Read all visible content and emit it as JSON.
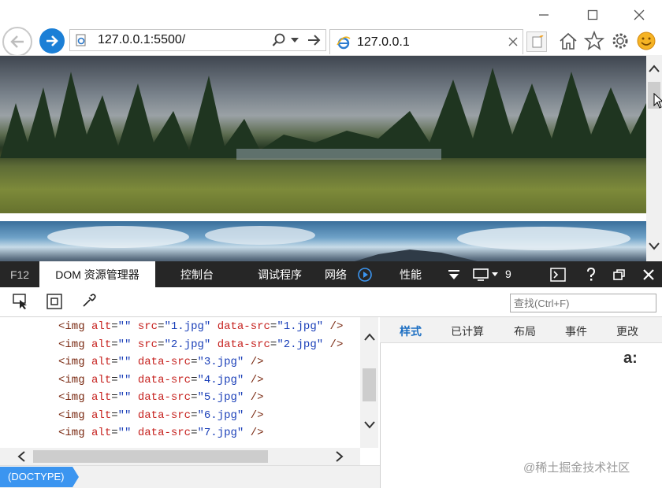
{
  "browser": {
    "address": "127.0.0.1:5500/",
    "tab_title": "127.0.0.1"
  },
  "devtools": {
    "tabs": [
      "F12",
      "DOM 资源管理器",
      "控制台",
      "调试程序",
      "网络",
      "性能"
    ],
    "error_count": "9",
    "find_placeholder": "查找(Ctrl+F)",
    "dom_lines": [
      {
        "tag": "<img",
        "a1": "alt",
        "v1": "\"\"",
        "a2": "src",
        "v2": "\"1.jpg\"",
        "a3": "data-src",
        "v3": "\"1.jpg\"",
        "end": " />"
      },
      {
        "tag": "<img",
        "a1": "alt",
        "v1": "\"\"",
        "a2": "src",
        "v2": "\"2.jpg\"",
        "a3": "data-src",
        "v3": "\"2.jpg\"",
        "end": " />"
      },
      {
        "tag": "<img",
        "a1": "alt",
        "v1": "\"\"",
        "a2": "data-src",
        "v2": "\"3.jpg\"",
        "end": " />"
      },
      {
        "tag": "<img",
        "a1": "alt",
        "v1": "\"\"",
        "a2": "data-src",
        "v2": "\"4.jpg\"",
        "end": " />"
      },
      {
        "tag": "<img",
        "a1": "alt",
        "v1": "\"\"",
        "a2": "data-src",
        "v2": "\"5.jpg\"",
        "end": " />"
      },
      {
        "tag": "<img",
        "a1": "alt",
        "v1": "\"\"",
        "a2": "data-src",
        "v2": "\"6.jpg\"",
        "end": " />"
      },
      {
        "tag": "<img",
        "a1": "alt",
        "v1": "\"\"",
        "a2": "data-src",
        "v2": "\"7.jpg\"",
        "end": " />"
      }
    ],
    "style_tabs": [
      "样式",
      "已计算",
      "布局",
      "事件",
      "更改"
    ],
    "pseudo_label": "a:",
    "breadcrumb": "(DOCTYPE)"
  },
  "watermark": "@稀土掘金技术社区",
  "colors": {
    "accent": "#1b7fd6",
    "breadcrumb": "#3b95f0",
    "devtools_bar": "#262626"
  }
}
